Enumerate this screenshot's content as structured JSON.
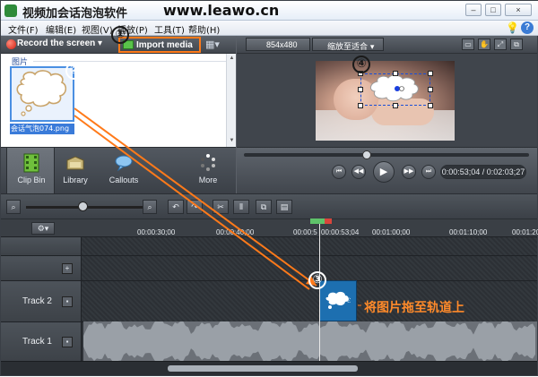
{
  "window": {
    "title": "视频加会话泡泡软件",
    "watermark": "www.leawo.cn"
  },
  "window_buttons": [
    "–",
    "□",
    "×"
  ],
  "menu": {
    "items": [
      "文件(F)",
      "编辑(E)",
      "视图(V)",
      "播放(P)",
      "工具(T)",
      "帮助(H)"
    ]
  },
  "toolbar": {
    "record_label": "Record the screen",
    "import_label": "Import media",
    "accent": "#ff7a1a"
  },
  "clipbin": {
    "section_label": "图片",
    "item_label": "会话气泡074.png"
  },
  "tabs": [
    {
      "label": "Clip Bin",
      "icon": "film-icon",
      "active": true
    },
    {
      "label": "Library",
      "icon": "library-icon",
      "active": false
    },
    {
      "label": "Callouts",
      "icon": "callout-icon",
      "active": false
    },
    {
      "label": "More",
      "icon": "more-icon",
      "active": false
    }
  ],
  "preview": {
    "dimensions": "854x480",
    "zoom_select": "缩放至适合"
  },
  "playback": {
    "timecode": "0:00:53;04 / 0:02:03;27",
    "progress": 0.43
  },
  "ruler": {
    "ticks": [
      "00:00:30;00",
      "00:00:40;00",
      "00:00:5",
      "00:00:53;04",
      "00:01:00;00",
      "00:01:10;00",
      "00:01:20"
    ]
  },
  "tracks": [
    {
      "name": "Track 2"
    },
    {
      "name": "Track 1"
    }
  ],
  "annotations": {
    "markers": [
      "①",
      "②",
      "③",
      "④"
    ],
    "drag_hint": "将图片拖至轨道上",
    "arrow_color": "#ff7a1a"
  }
}
